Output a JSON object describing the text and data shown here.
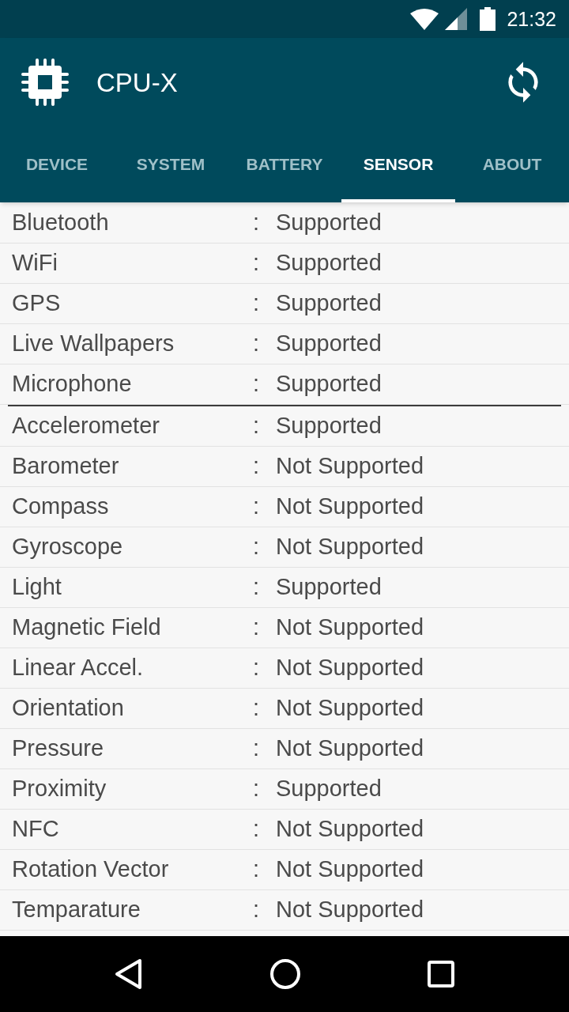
{
  "status_bar": {
    "time": "21:32"
  },
  "app_bar": {
    "title": "CPU-X"
  },
  "tabs": [
    {
      "label": "DEVICE",
      "selected": false
    },
    {
      "label": "SYSTEM",
      "selected": false
    },
    {
      "label": "BATTERY",
      "selected": false
    },
    {
      "label": "SENSOR",
      "selected": true
    },
    {
      "label": "ABOUT",
      "selected": false
    }
  ],
  "sections": [
    {
      "rows": [
        {
          "name": "Bluetooth",
          "separator": ":",
          "value": "Supported"
        },
        {
          "name": "WiFi",
          "separator": ":",
          "value": "Supported"
        },
        {
          "name": "GPS",
          "separator": ":",
          "value": "Supported"
        },
        {
          "name": "Live Wallpapers",
          "separator": ":",
          "value": "Supported"
        },
        {
          "name": "Microphone",
          "separator": ":",
          "value": "Supported"
        }
      ]
    },
    {
      "rows": [
        {
          "name": "Accelerometer",
          "separator": ":",
          "value": "Supported"
        },
        {
          "name": "Barometer",
          "separator": ":",
          "value": "Not Supported"
        },
        {
          "name": "Compass",
          "separator": ":",
          "value": "Not Supported"
        },
        {
          "name": "Gyroscope",
          "separator": ":",
          "value": "Not Supported"
        },
        {
          "name": "Light",
          "separator": ":",
          "value": "Supported"
        },
        {
          "name": "Magnetic Field",
          "separator": ":",
          "value": "Not Supported"
        },
        {
          "name": "Linear Accel.",
          "separator": ":",
          "value": "Not Supported"
        },
        {
          "name": "Orientation",
          "separator": ":",
          "value": "Not Supported"
        },
        {
          "name": "Pressure",
          "separator": ":",
          "value": "Not Supported"
        },
        {
          "name": "Proximity",
          "separator": ":",
          "value": "Supported"
        },
        {
          "name": "NFC",
          "separator": ":",
          "value": "Not Supported"
        },
        {
          "name": "Rotation Vector",
          "separator": ":",
          "value": "Not Supported"
        },
        {
          "name": "Temparature",
          "separator": ":",
          "value": "Not Supported"
        }
      ]
    }
  ]
}
